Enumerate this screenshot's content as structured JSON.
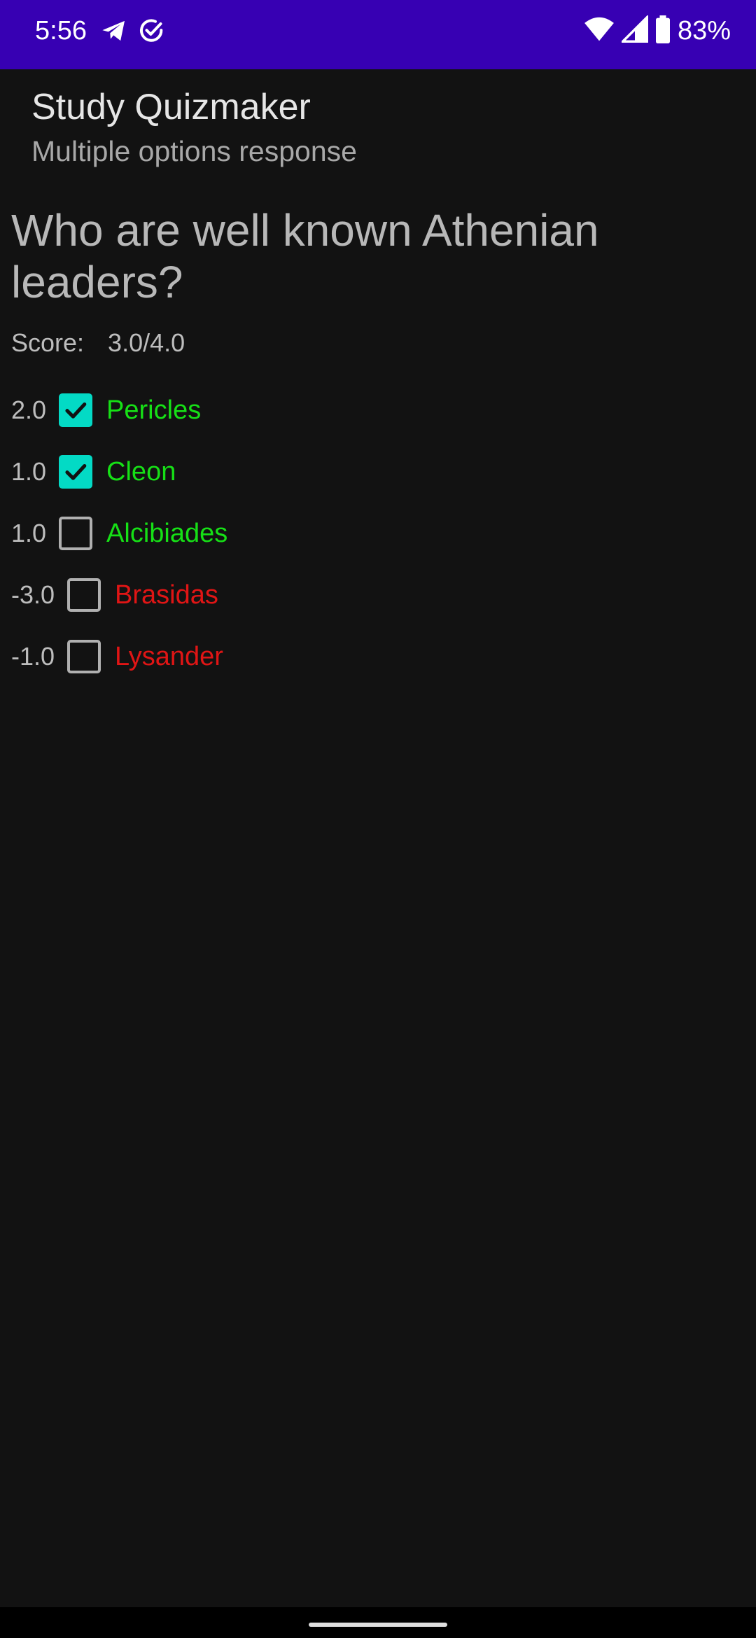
{
  "status_bar": {
    "time": "5:56",
    "battery": "83%",
    "left_icons": [
      "telegram-icon",
      "check-circle-icon"
    ],
    "right_icons": [
      "wifi-icon",
      "signal-icon",
      "battery-icon"
    ]
  },
  "app_bar": {
    "title": "Study Quizmaker",
    "subtitle": "Multiple options response"
  },
  "question": {
    "text": "Who are well known Athenian leaders?"
  },
  "score": {
    "label": "Score:",
    "value": "3.0/4.0"
  },
  "options": [
    {
      "points": "2.0",
      "label": "Pericles",
      "checked": true,
      "correct": true
    },
    {
      "points": "1.0",
      "label": "Cleon",
      "checked": true,
      "correct": true
    },
    {
      "points": "1.0",
      "label": "Alcibiades",
      "checked": false,
      "correct": true
    },
    {
      "points": "-3.0",
      "label": "Brasidas",
      "checked": false,
      "correct": false
    },
    {
      "points": "-1.0",
      "label": "Lysander",
      "checked": false,
      "correct": false
    }
  ],
  "colors": {
    "status_bar": "#3700B3",
    "background": "#121212",
    "checkbox_checked": "#03DAC5",
    "correct_text": "#16e016",
    "wrong_text": "#e01515"
  }
}
